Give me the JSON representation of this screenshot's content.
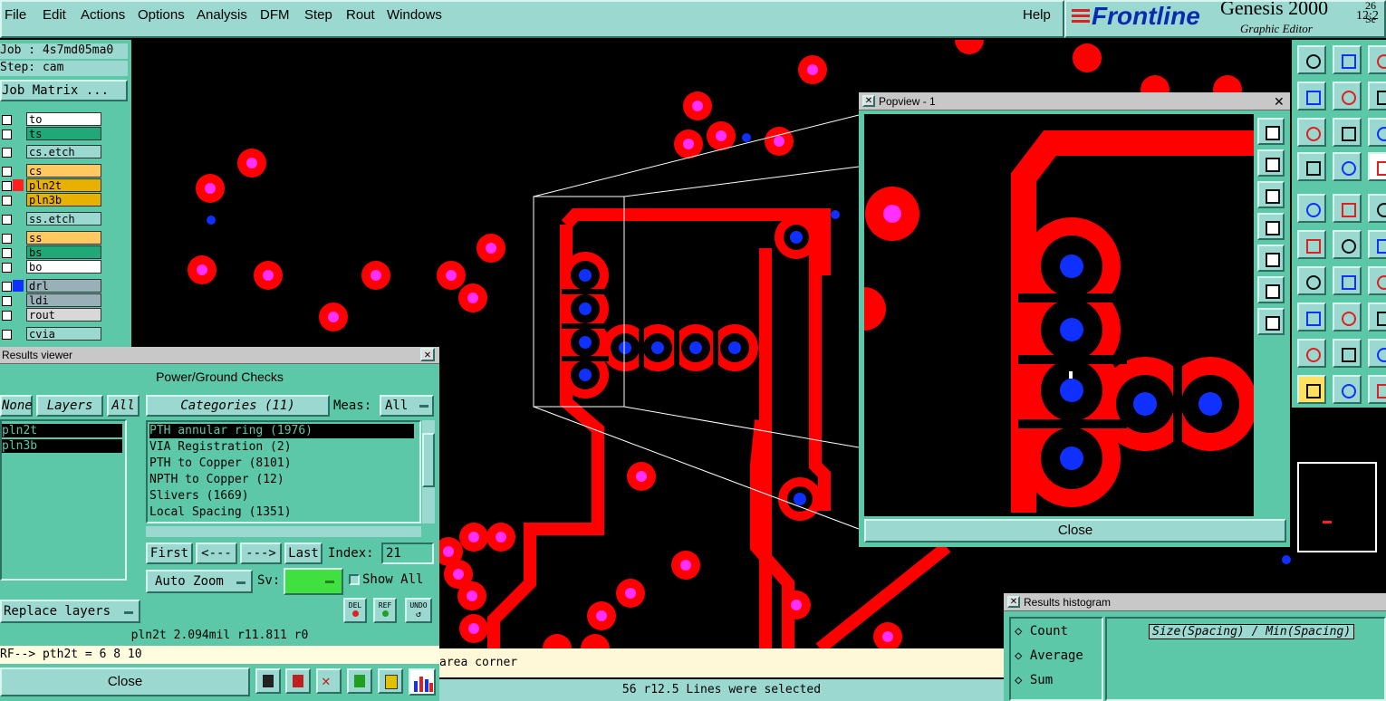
{
  "menu": [
    "File",
    "Edit",
    "Actions",
    "Options",
    "Analysis",
    "DFM",
    "Step",
    "Rout",
    "Windows"
  ],
  "help": "Help",
  "brand": {
    "logo": "Frontline",
    "product": "Genesis 2000",
    "subtitle": "Graphic Editor",
    "date": "26 Se",
    "time": "12:2"
  },
  "job": {
    "job_line": "Job : 4s7md05ma0",
    "step_line": "Step: cam",
    "matrix_button": "Job Matrix ..."
  },
  "layers": [
    {
      "name": "to",
      "color": "#ffffff",
      "swatch": ""
    },
    {
      "name": "ts",
      "color": "#20a878",
      "swatch": ""
    },
    {
      "name": "cs.etch",
      "color": "#9ad8d0",
      "swatch": ""
    },
    {
      "name": "cs",
      "color": "#ffc860",
      "swatch": ""
    },
    {
      "name": "pln2t",
      "color": "#e8b000",
      "swatch": "#ff2020"
    },
    {
      "name": "pln3b",
      "color": "#e8b000",
      "swatch": ""
    },
    {
      "name": "ss.etch",
      "color": "#9ad8d0",
      "swatch": ""
    },
    {
      "name": "ss",
      "color": "#ffc860",
      "swatch": ""
    },
    {
      "name": "bs",
      "color": "#20a878",
      "swatch": ""
    },
    {
      "name": "bo",
      "color": "#ffffff",
      "swatch": ""
    },
    {
      "name": "drl",
      "color": "#9ab0b8",
      "swatch": "#1030ff"
    },
    {
      "name": "ldi",
      "color": "#9ab0b8",
      "swatch": ""
    },
    {
      "name": "rout",
      "color": "#d8d8d8",
      "swatch": ""
    },
    {
      "name": "cvia",
      "color": "#9ad8d0",
      "swatch": ""
    }
  ],
  "results_viewer": {
    "title": "Results viewer",
    "header": "Power/Ground Checks",
    "none_btn": "None",
    "layers_btn": "Layers",
    "all_btn": "All",
    "layer_items": [
      "pln2t",
      "pln3b"
    ],
    "categories_btn": "Categories (11)",
    "meas_label": "Meas:",
    "meas_value": "All",
    "categories": [
      "PTH annular ring (1976)",
      "VIA Registration (2)",
      "PTH to Copper (8101)",
      "NPTH to Copper (12)",
      "Slivers (1669)",
      "Local Spacing (1351)"
    ],
    "first": "First",
    "prev": "<---",
    "next": "--->",
    "last": "Last",
    "index_label": "Index:",
    "index_value": "21",
    "auto_zoom": "Auto Zoom",
    "sv_label": "Sv:",
    "show_all": "Show All",
    "replace_layers": "Replace layers",
    "del": "DEL",
    "ref": "REF",
    "undo": "UNDO",
    "info_line": "pln2t 2.094mil  r11.811  r0",
    "rf_line": "RF--> pth2t = 6 8 10",
    "close": "Close"
  },
  "popview": {
    "title": "Popview - 1",
    "close": "Close"
  },
  "histogram": {
    "title": "Results histogram",
    "options": [
      "Count",
      "Average",
      "Sum"
    ],
    "axis_label": "Size(Spacing) / Min(Spacing)"
  },
  "status": {
    "prompt": "area corner",
    "selection": "56 r12.5 Lines were selected"
  },
  "colors": {
    "pad": "#ff0000",
    "pad_center": "#ff30ff",
    "drill": "#1030ff",
    "panel": "#5cc8a8",
    "button": "#9ad8d0"
  }
}
